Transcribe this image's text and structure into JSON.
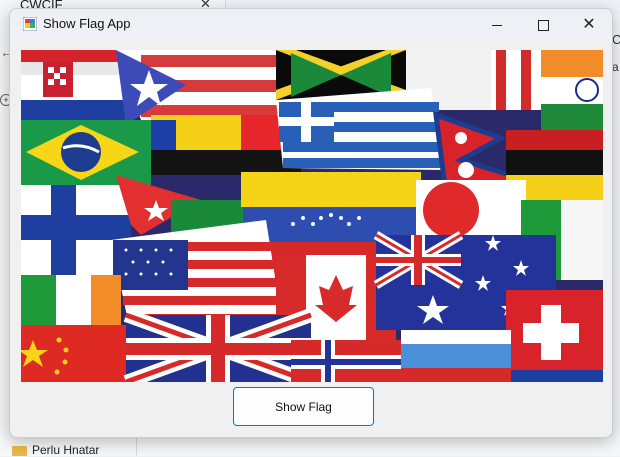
{
  "background": {
    "tab_title": "CWCIF",
    "tab_close": "✕",
    "back_arrow": "←",
    "right_char": "C",
    "right_char2": "a",
    "folder_label": "Perlu Hnatar"
  },
  "window": {
    "title": "Show Flag App",
    "minimize": "",
    "maximize": "",
    "close": "✕"
  },
  "image": {
    "description_icon": "flags-collage-image"
  },
  "button": {
    "label": "Show Flag"
  },
  "colors": {
    "accent": "#0078d4",
    "titlebar": "#eef0f5",
    "window_bg": "#f0f0f0"
  }
}
